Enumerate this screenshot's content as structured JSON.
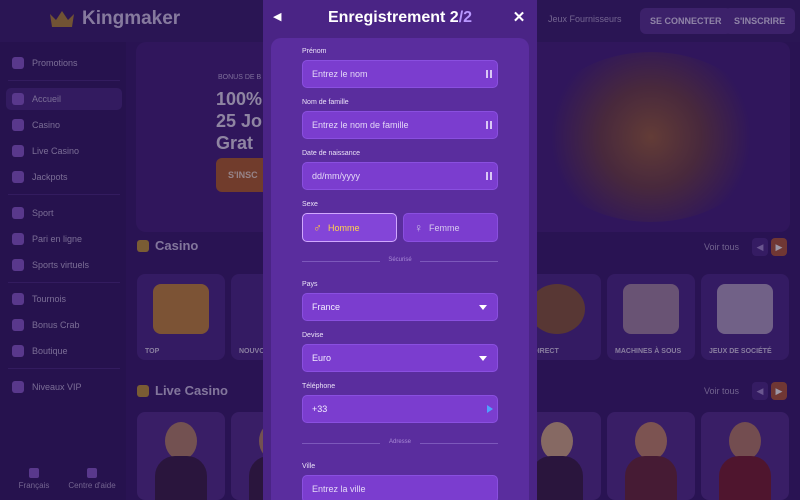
{
  "background": {
    "brand": "Kingmaker",
    "header": {
      "partners_label": "Jeux Fournisseurs",
      "login_label": "SE CONNECTER",
      "signup_label": "S'INSCRIRE"
    },
    "sidebar": {
      "items": [
        {
          "label": "Promotions",
          "icon": "gift-icon"
        },
        {
          "label": "Accueil",
          "icon": "home-icon",
          "active": true
        },
        {
          "label": "Casino",
          "icon": "slot-icon"
        },
        {
          "label": "Live Casino",
          "icon": "play-icon"
        },
        {
          "label": "Jackpots",
          "icon": "coins-icon"
        },
        {
          "label": "Sport",
          "icon": "soccer-icon"
        },
        {
          "label": "Pari en ligne",
          "icon": "tv-icon"
        },
        {
          "label": "Sports virtuels",
          "icon": "gamepad-icon"
        },
        {
          "label": "Tournois",
          "icon": "trophy-icon"
        },
        {
          "label": "Bonus Crab",
          "icon": "crab-icon"
        },
        {
          "label": "Boutique",
          "icon": "shop-icon"
        },
        {
          "label": "Niveaux VIP",
          "icon": "crown-icon"
        }
      ],
      "footer": [
        {
          "label": "Français",
          "icon": "flag-icon"
        },
        {
          "label": "Centre d'aide",
          "icon": "help-icon"
        }
      ]
    },
    "hero": {
      "small_text": "BONUS DE B",
      "line1": "100%",
      "line2": "25 Jo",
      "line3": "Grat",
      "cta": "S'INSC"
    },
    "casino_section": {
      "title": "Casino",
      "see_all": "Voir tous",
      "tiles": [
        "TOP",
        "NOUVO",
        "",
        "",
        "EN DIRECT",
        "MACHINES À SOUS",
        "JEUX DE SOCIÉTÉ"
      ]
    },
    "live_section": {
      "title": "Live Casino",
      "see_all": "Voir tous"
    }
  },
  "modal": {
    "title": "Enregistrement",
    "step": "2",
    "total": "/2",
    "fields": {
      "first_name": {
        "label": "Prénom",
        "placeholder": "Entrez le nom"
      },
      "last_name": {
        "label": "Nom de famille",
        "placeholder": "Entrez le nom de famille"
      },
      "birth_date": {
        "label": "Date de naissance",
        "placeholder": "dd/mm/yyyy"
      },
      "gender": {
        "label": "Sexe",
        "options": [
          "Homme",
          "Femme"
        ],
        "selected": "Homme"
      },
      "security_divider": "Sécurisé",
      "country": {
        "label": "Pays",
        "value": "France"
      },
      "currency": {
        "label": "Devise",
        "value": "Euro"
      },
      "phone": {
        "label": "Téléphone",
        "value": "+33"
      },
      "address_divider": "Adresse",
      "city": {
        "label": "Ville",
        "placeholder": "Entrez la ville"
      }
    }
  },
  "colors": {
    "modal_bg": "#4a2485",
    "form_bg": "#5a2d9e",
    "field_bg": "#7b3dcf",
    "accent_gold": "#ffc53d",
    "accent_purple": "#b998ff"
  }
}
